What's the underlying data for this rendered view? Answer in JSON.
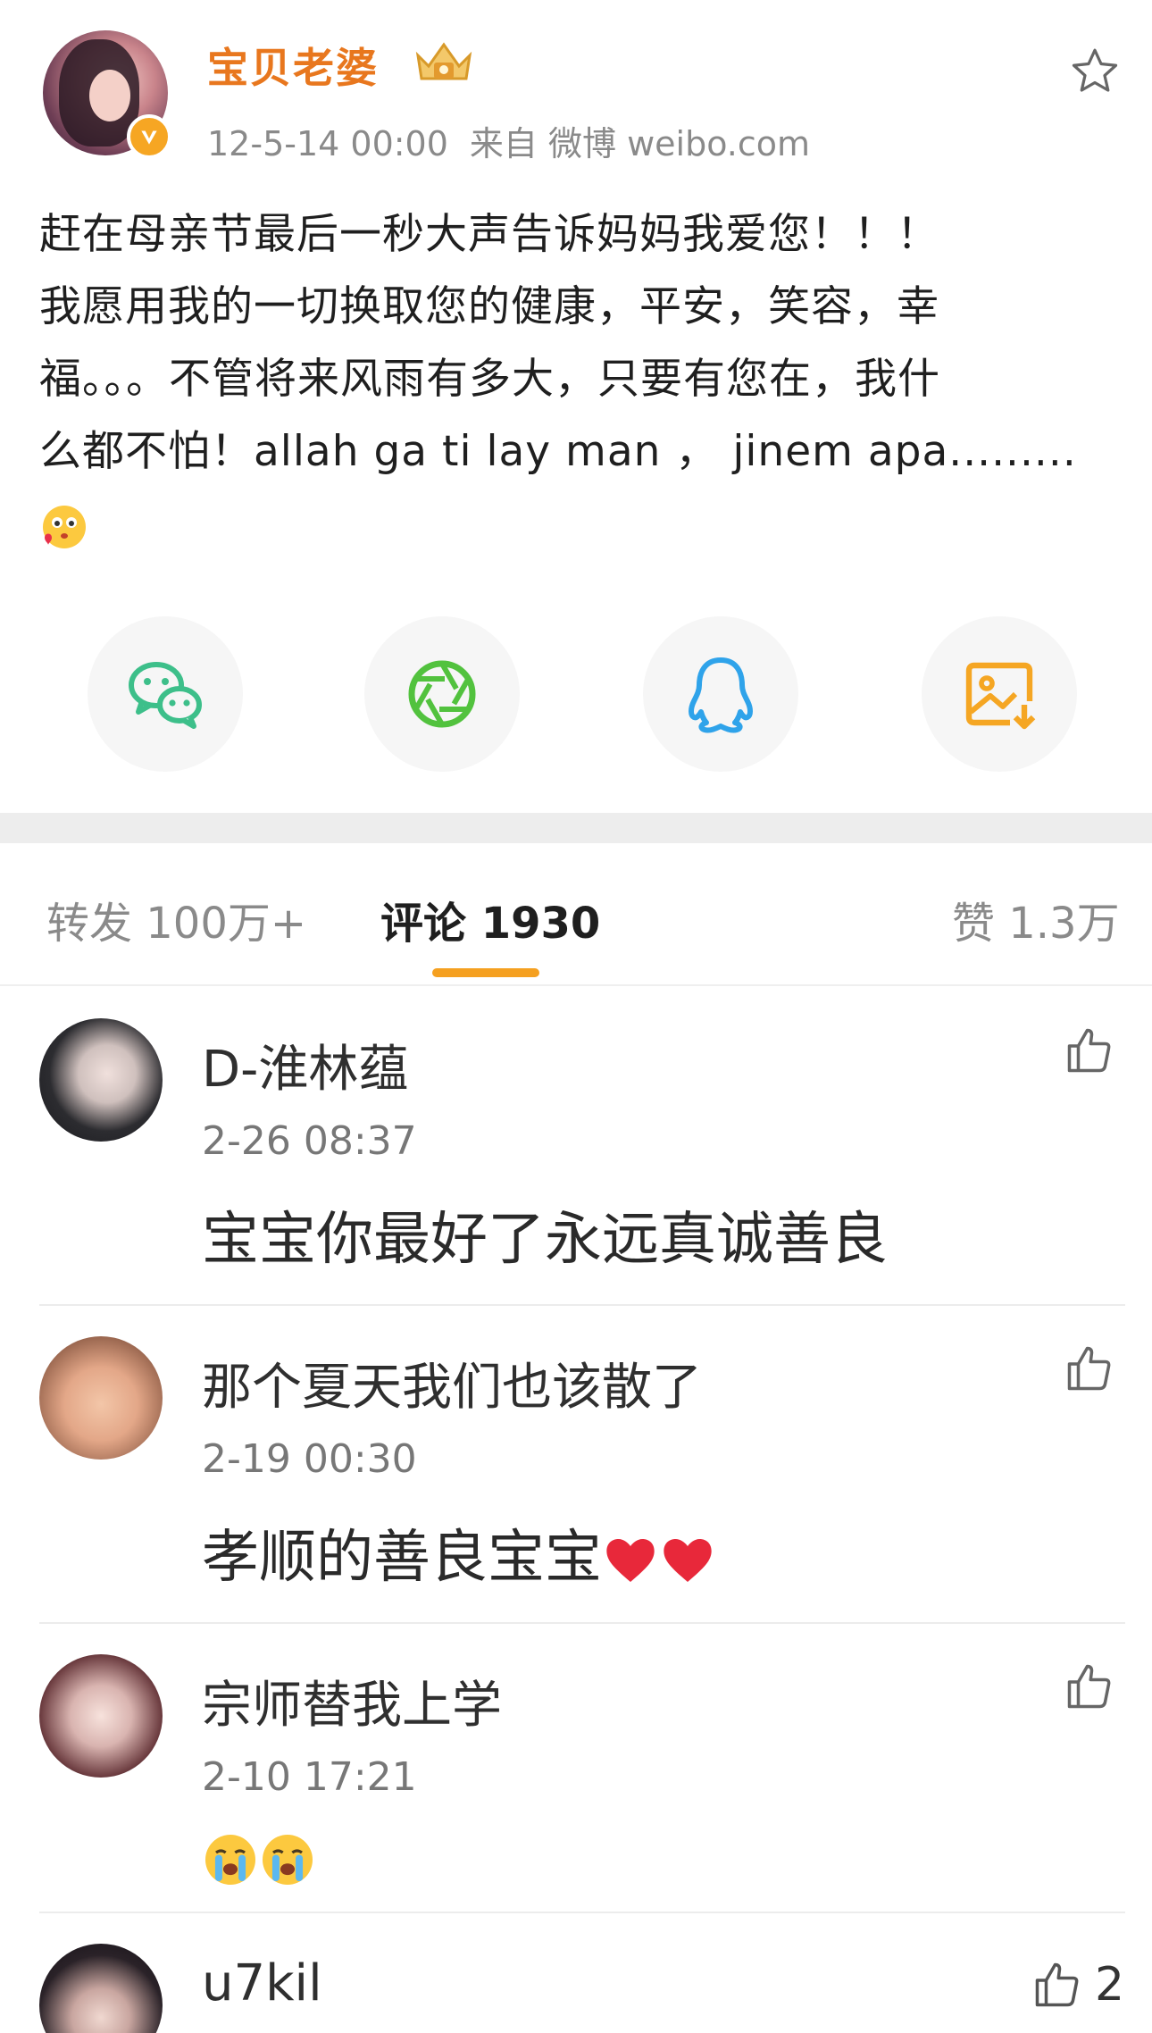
{
  "post": {
    "author_name": "宝贝老婆",
    "timestamp": "12-5-14 00:00",
    "source": "来自 微博 weibo.com",
    "text_lines": [
      "赶在母亲节最后一秒大声告诉妈妈我爱您！！！",
      "我愿用我的一切换取您的健康，平安，笑容，幸",
      "福。。。不管将来风雨有多大，只要有您在，我什",
      "么都不怕！allah ga ti lay man ， jinem apa........."
    ],
    "trailing_emoji": "kiss-face-emoji"
  },
  "share": {
    "buttons": [
      {
        "name": "wechat",
        "icon": "wechat-icon",
        "color": "#3dbf8a"
      },
      {
        "name": "moments",
        "icon": "moments-shutter-icon",
        "color": "#52c23e"
      },
      {
        "name": "qq",
        "icon": "qq-penguin-icon",
        "color": "#2fa3ea"
      },
      {
        "name": "save-image",
        "icon": "save-image-icon",
        "color": "#f5a623"
      }
    ]
  },
  "tabs": {
    "repost": "转发 100万+",
    "comment": "评论 1930",
    "like": "赞 1.3万",
    "active": "comment",
    "accent": "#f5a020"
  },
  "comments": [
    {
      "name": "D-淮林蕴",
      "time": "2-26 08:37",
      "text": "宝宝你最好了永远真诚善良",
      "likes": ""
    },
    {
      "name": "那个夏天我们也该散了",
      "time": "2-19 00:30",
      "text": "孝顺的善良宝宝",
      "emoji": [
        "red-heart",
        "red-heart"
      ],
      "likes": ""
    },
    {
      "name": "宗师替我上学",
      "time": "2-10 17:21",
      "text": "",
      "emoji": [
        "loudly-crying-face",
        "loudly-crying-face"
      ],
      "likes": ""
    },
    {
      "name": "u7kil",
      "time": "",
      "text": "",
      "likes": "2"
    }
  ],
  "colors": {
    "author_name": "#e8771e",
    "verified": "#f6a623",
    "meta_text": "#8a8a8a"
  }
}
